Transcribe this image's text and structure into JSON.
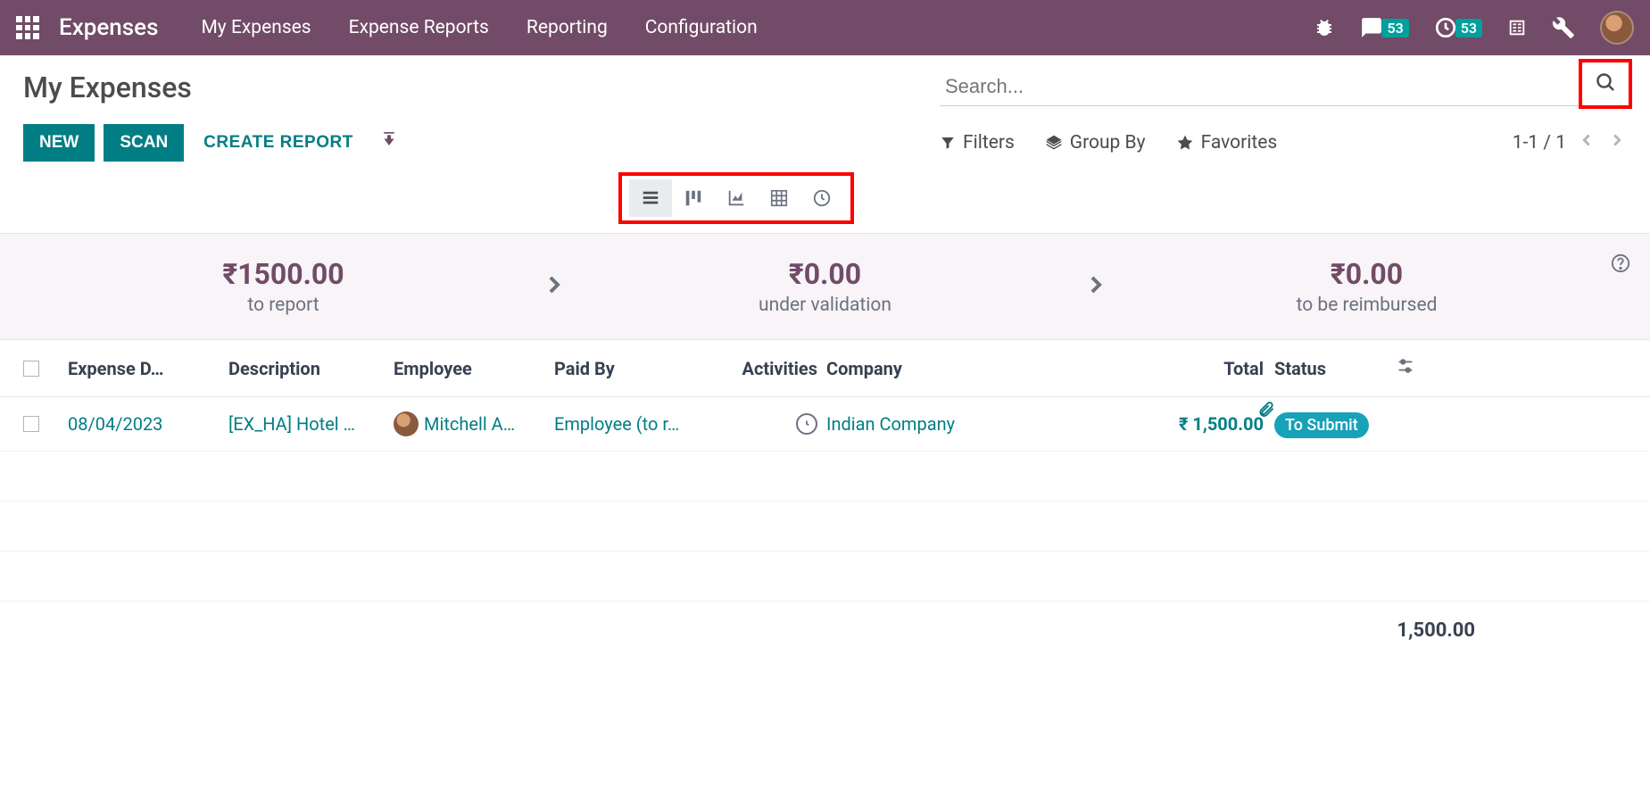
{
  "topbar": {
    "app_name": "Expenses",
    "menu": [
      "My Expenses",
      "Expense Reports",
      "Reporting",
      "Configuration"
    ],
    "msg_badge": "53",
    "activity_badge": "53"
  },
  "control": {
    "title": "My Expenses",
    "search_placeholder": "Search...",
    "btn_new": "NEW",
    "btn_scan": "SCAN",
    "btn_create_report": "CREATE REPORT",
    "filters": "Filters",
    "groupby": "Group By",
    "favorites": "Favorites",
    "pager": "1-1 / 1"
  },
  "dashboard": {
    "col1_amount": "₹1500.00",
    "col1_label": "to report",
    "col2_amount": "₹0.00",
    "col2_label": "under validation",
    "col3_amount": "₹0.00",
    "col3_label": "to be reimbursed"
  },
  "table": {
    "headers": {
      "date": "Expense D…",
      "desc": "Description",
      "emp": "Employee",
      "paid": "Paid By",
      "act": "Activities",
      "comp": "Company",
      "tot": "Total",
      "stat": "Status"
    },
    "rows": [
      {
        "date": "08/04/2023",
        "desc": "[EX_HA] Hotel …",
        "emp": "Mitchell A…",
        "paid": "Employee (to r…",
        "comp": "Indian Company",
        "tot": "₹ 1,500.00",
        "stat": "To Submit"
      }
    ],
    "footer_total": "1,500.00"
  }
}
